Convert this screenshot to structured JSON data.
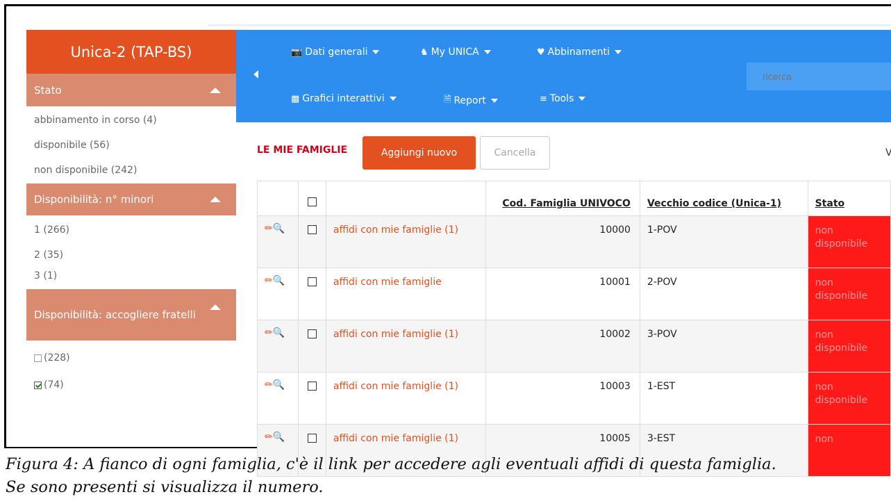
{
  "sidebar": {
    "title": "Unica-2 (TAP-BS)",
    "sections": [
      {
        "title": "Stato",
        "items": [
          "abbinamento in corso (4)",
          "disponibile (56)",
          "non disponibile (242)"
        ]
      },
      {
        "title": "Disponibilità: n° minori",
        "items": [
          "1 (266)",
          "2 (35)",
          "3 (1)"
        ]
      },
      {
        "title": "Disponibilità: accogliere fratelli",
        "items": [
          "(228)",
          "(74)"
        ]
      }
    ]
  },
  "nav": {
    "row1": [
      "Dati generali",
      "My UNICA",
      "Abbinamenti"
    ],
    "row2": [
      "Grafici interattivi",
      "Report",
      "Tools"
    ],
    "search_placeholder": "ricerca"
  },
  "toolbar": {
    "title": "LE MIE FAMIGLIE",
    "add_label": "Aggiungi nuovo",
    "cancel_label": "Cancella",
    "cut_text": "V"
  },
  "table": {
    "headers": {
      "code": "Cod. Famiglia UNIVOCO",
      "old": "Vecchio codice (Unica-1)",
      "status": "Stato"
    },
    "rows": [
      {
        "link": "affidi con mie famiglie (1)",
        "code": "10000",
        "old": "1-POV",
        "status_1": "non",
        "status_2": "disponibile"
      },
      {
        "link": "affidi con mie famiglie",
        "code": "10001",
        "old": "2-POV",
        "status_1": "non",
        "status_2": "disponibile"
      },
      {
        "link": "affidi con mie famiglie (1)",
        "code": "10002",
        "old": "3-POV",
        "status_1": "non",
        "status_2": "disponibile"
      },
      {
        "link": "affidi con mie famiglie (1)",
        "code": "10003",
        "old": "1-EST",
        "status_1": "non",
        "status_2": "disponibile"
      },
      {
        "link": "affidi con mie famiglie (1)",
        "code": "10005",
        "old": "3-EST",
        "status_1": "non",
        "status_2": ""
      }
    ]
  },
  "caption": {
    "line1": "Figura 4: A fianco di ogni famiglia, c'è il link per accedere agli eventuali affidi di questa famiglia.",
    "line2": "Se sono presenti si visualizza il numero."
  },
  "colors": {
    "brand": "#e2511f",
    "header": "#2d8ef0",
    "section": "#d98a6f",
    "status_red": "#ff1a1a"
  }
}
